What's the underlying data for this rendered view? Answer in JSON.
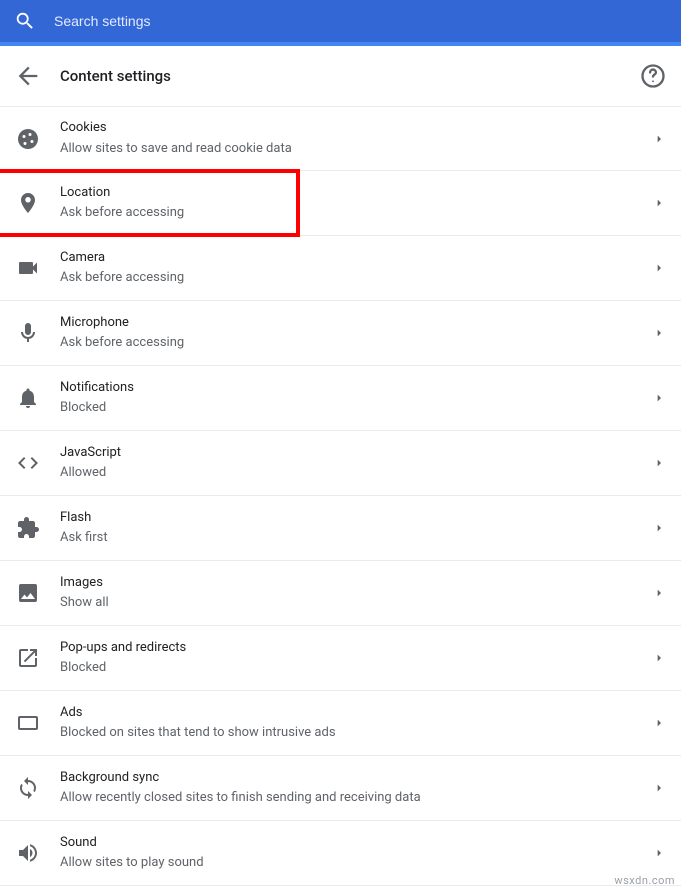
{
  "search": {
    "placeholder": "Search settings"
  },
  "header": {
    "title": "Content settings"
  },
  "items": [
    {
      "id": "cookies",
      "label": "Cookies",
      "sub": "Allow sites to save and read cookie data",
      "highlight": false
    },
    {
      "id": "location",
      "label": "Location",
      "sub": "Ask before accessing",
      "highlight": true
    },
    {
      "id": "camera",
      "label": "Camera",
      "sub": "Ask before accessing",
      "highlight": false
    },
    {
      "id": "microphone",
      "label": "Microphone",
      "sub": "Ask before accessing",
      "highlight": false
    },
    {
      "id": "notifications",
      "label": "Notifications",
      "sub": "Blocked",
      "highlight": false
    },
    {
      "id": "javascript",
      "label": "JavaScript",
      "sub": "Allowed",
      "highlight": false
    },
    {
      "id": "flash",
      "label": "Flash",
      "sub": "Ask first",
      "highlight": false
    },
    {
      "id": "images",
      "label": "Images",
      "sub": "Show all",
      "highlight": false
    },
    {
      "id": "popups",
      "label": "Pop-ups and redirects",
      "sub": "Blocked",
      "highlight": false
    },
    {
      "id": "ads",
      "label": "Ads",
      "sub": "Blocked on sites that tend to show intrusive ads",
      "highlight": false
    },
    {
      "id": "background-sync",
      "label": "Background sync",
      "sub": "Allow recently closed sites to finish sending and receiving data",
      "highlight": false
    },
    {
      "id": "sound",
      "label": "Sound",
      "sub": "Allow sites to play sound",
      "highlight": false
    }
  ],
  "watermark": "wsxdn.com"
}
